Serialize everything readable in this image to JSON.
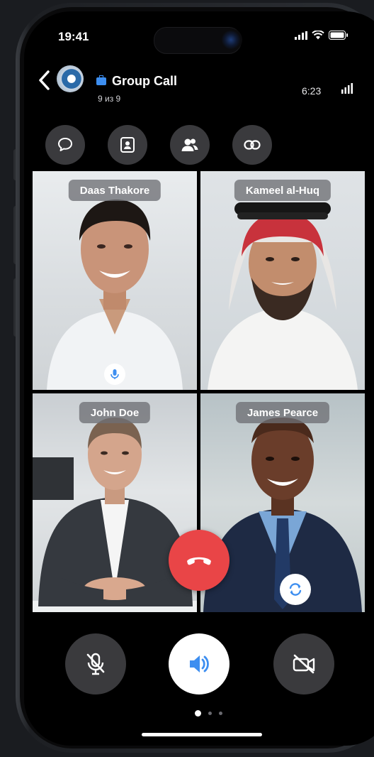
{
  "status": {
    "time": "19:41"
  },
  "header": {
    "title": "Group Call",
    "subtitle": "9 из 9",
    "duration": "6:23"
  },
  "actions": [
    "chat-icon",
    "contact-card-icon",
    "participants-icon",
    "link-icon"
  ],
  "participants": [
    {
      "name": "Daas Thakore",
      "speaking": true
    },
    {
      "name": "Kameel al-Huq",
      "speaking": false
    },
    {
      "name": "John Doe",
      "speaking": false
    },
    {
      "name": "James Pearce",
      "speaking": false
    }
  ],
  "controls": {
    "mic": "mic-muted-icon",
    "speaker": "speaker-icon",
    "camera": "camera-off-icon",
    "end_call": "end-call-icon"
  },
  "pager": {
    "pages": 3,
    "current": 1
  },
  "colors": {
    "accent": "#3d8ef0",
    "end_call": "#e94547",
    "background": "#000000"
  }
}
